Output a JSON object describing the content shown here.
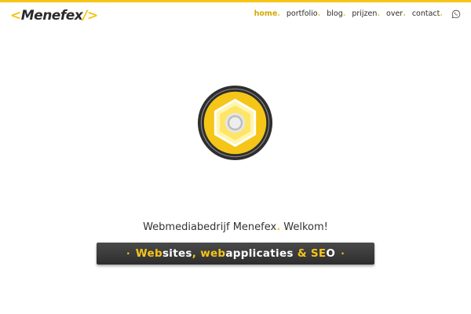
{
  "brand": {
    "open_bracket": "<",
    "name": "Menefex",
    "slash": "/",
    "close_bracket": ">",
    "accent_color": "#f5c518",
    "dark_color": "#2b2b2b"
  },
  "nav": {
    "items": [
      {
        "label": "home",
        "dot": ".",
        "active": true
      },
      {
        "label": "portfolio",
        "dot": "."
      },
      {
        "label": "blog",
        "dot": "."
      },
      {
        "label": "prijzen",
        "dot": "."
      },
      {
        "label": "over",
        "dot": "."
      },
      {
        "label": "contact",
        "dot": "."
      }
    ],
    "whatsapp_icon": "whatsapp-icon"
  },
  "hero": {
    "emblem_icon": "hex-nut-icon",
    "headline_before": "Webmediabedrijf Menefex",
    "headline_dot": ".",
    "headline_after": " Welkom!",
    "tagline": {
      "bullet_left": "·",
      "p1_yellow": "Web",
      "p1_white": "sites",
      "comma": ", ",
      "p2_yellow": "web",
      "p2_white": "applicaties",
      "amp": " & ",
      "p3_yellow": "SE",
      "p3_white": "O",
      "bullet_right": "·"
    }
  }
}
